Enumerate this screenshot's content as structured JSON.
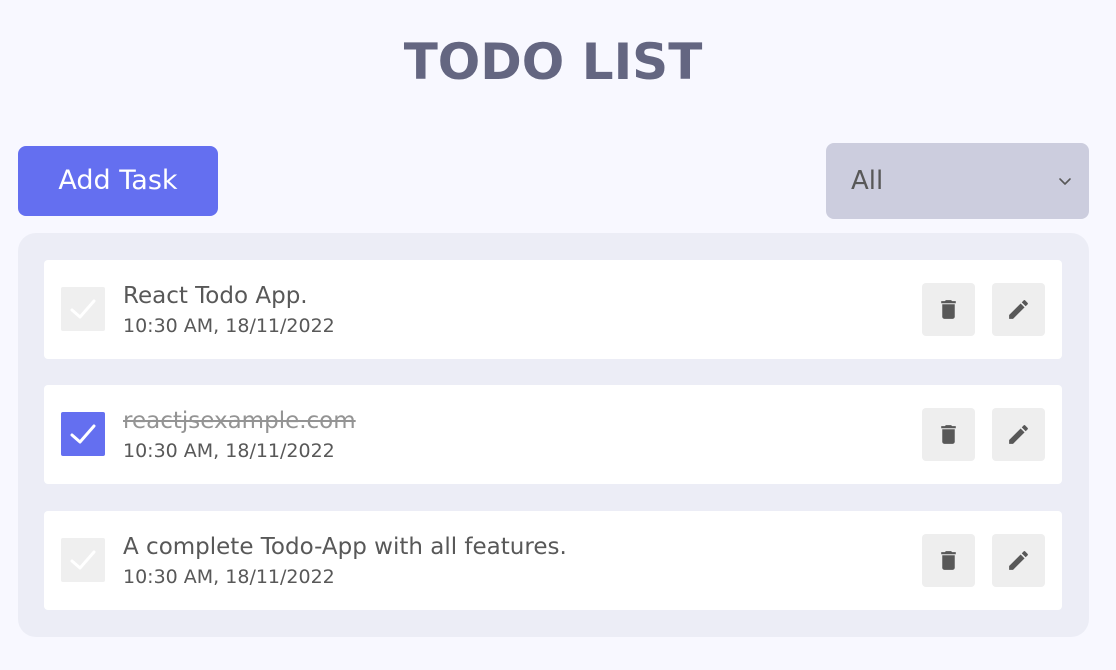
{
  "app": {
    "title": "TODO LIST"
  },
  "toolbar": {
    "add_label": "Add Task",
    "filter": {
      "selected": "All"
    }
  },
  "todos": [
    {
      "title": "React Todo App.",
      "time": "10:30 AM, 18/11/2022",
      "completed": false
    },
    {
      "title": "reactjsexample.com",
      "time": "10:30 AM, 18/11/2022",
      "completed": true
    },
    {
      "title": "A complete Todo-App with all features.",
      "time": "10:30 AM, 18/11/2022",
      "completed": false
    }
  ],
  "colors": {
    "accent": "#646ff0",
    "background": "#f8f8ff",
    "panel": "#ecedf6",
    "title": "#646681",
    "select": "#cccdde",
    "icon_button": "#eeeeee"
  },
  "icons": {
    "checkbox": "check-icon",
    "delete": "trash-icon",
    "edit": "pencil-icon",
    "filter": "chevron-down-icon"
  }
}
